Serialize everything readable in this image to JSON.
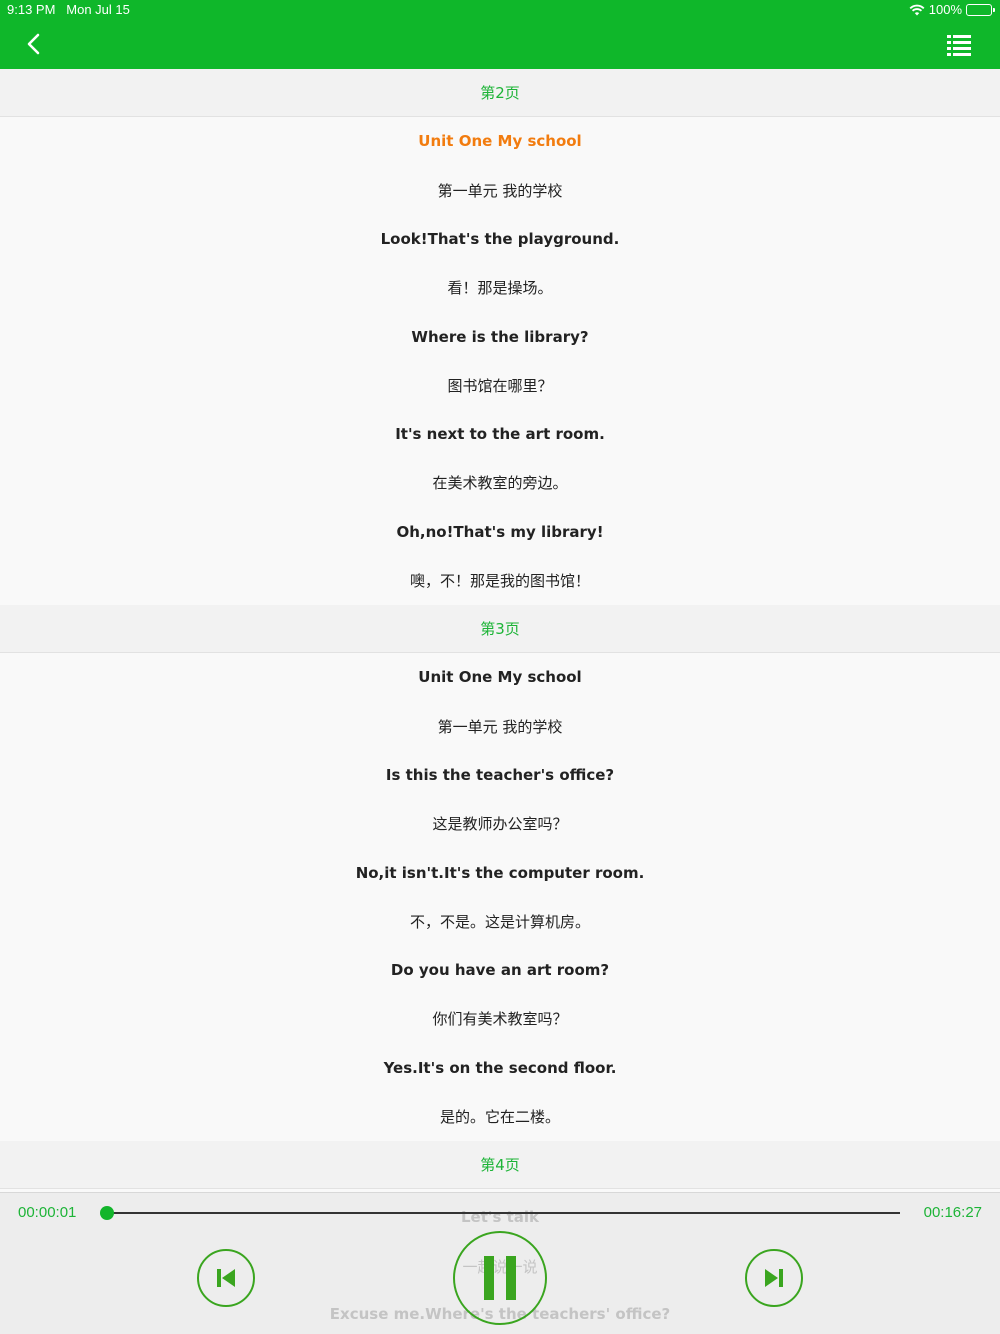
{
  "status": {
    "time": "9:13 PM",
    "date": "Mon Jul 15",
    "battery": "100%",
    "battery_level": 1.0
  },
  "colors": {
    "primary_green": "#0fb72a",
    "accent_orange": "#f27c0f",
    "page_header_bg": "#f2f2f2"
  },
  "nav": {
    "back_icon": "chevron-left-icon",
    "menu_icon": "list-icon"
  },
  "sections": [
    {
      "title": "第2页",
      "lines": [
        {
          "text": "Unit One My school",
          "lang": "en",
          "active": true
        },
        {
          "text": "第一单元 我的学校",
          "lang": "zh",
          "active": false
        },
        {
          "text": "Look!That's the playground.",
          "lang": "en",
          "active": false
        },
        {
          "text": "看！那是操场。",
          "lang": "zh",
          "active": false
        },
        {
          "text": "Where is the library?",
          "lang": "en",
          "active": false
        },
        {
          "text": "图书馆在哪里？",
          "lang": "zh",
          "active": false
        },
        {
          "text": "It's next to the art room.",
          "lang": "en",
          "active": false
        },
        {
          "text": "在美术教室的旁边。",
          "lang": "zh",
          "active": false
        },
        {
          "text": "Oh,no!That's my library!",
          "lang": "en",
          "active": false
        },
        {
          "text": "噢，不！那是我的图书馆！",
          "lang": "zh",
          "active": false
        }
      ]
    },
    {
      "title": "第3页",
      "lines": [
        {
          "text": "Unit One My school",
          "lang": "en",
          "active": false
        },
        {
          "text": "第一单元 我的学校",
          "lang": "zh",
          "active": false
        },
        {
          "text": "Is this the teacher's office?",
          "lang": "en",
          "active": false
        },
        {
          "text": "这是教师办公室吗？",
          "lang": "zh",
          "active": false
        },
        {
          "text": "No,it isn't.It's the computer room.",
          "lang": "en",
          "active": false
        },
        {
          "text": "不，不是。这是计算机房。",
          "lang": "zh",
          "active": false
        },
        {
          "text": "Do you have an art room?",
          "lang": "en",
          "active": false
        },
        {
          "text": "你们有美术教室吗？",
          "lang": "zh",
          "active": false
        },
        {
          "text": "Yes.It's on the second floor.",
          "lang": "en",
          "active": false
        },
        {
          "text": "是的。它在二楼。",
          "lang": "zh",
          "active": false
        }
      ]
    },
    {
      "title": "第4页",
      "lines": [
        {
          "text": "Let's talk",
          "lang": "en",
          "active": false
        },
        {
          "text": "一起说一说",
          "lang": "zh",
          "active": false
        },
        {
          "text": "Excuse me.Where's the teachers' office?",
          "lang": "en",
          "active": false
        }
      ]
    }
  ],
  "player": {
    "elapsed": "00:00:01",
    "total": "00:16:27",
    "progress": 0.001,
    "prev_icon": "skip-previous-icon",
    "pause_icon": "pause-icon",
    "next_icon": "skip-next-icon"
  }
}
